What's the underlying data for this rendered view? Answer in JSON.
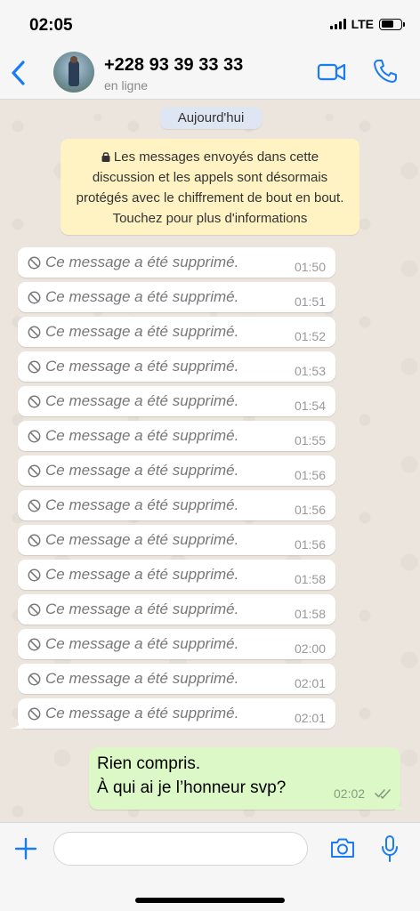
{
  "status_bar": {
    "time": "02:05",
    "network": "LTE",
    "battery_level": 0.62
  },
  "header": {
    "contact_name": "+228 93 39 33 33",
    "contact_status": "en ligne"
  },
  "chat": {
    "date_label": "Aujourd'hui",
    "encryption_notice": "Les messages envoyés dans cette discussion et les appels sont désormais protégés avec le chiffrement de bout en bout. Touchez pour plus d'informations",
    "deleted_messages": [
      {
        "text": "Ce message a été supprimé.",
        "time": "01:50"
      },
      {
        "text": "Ce message a été supprimé.",
        "time": "01:51"
      },
      {
        "text": "Ce message a été supprimé.",
        "time": "01:52"
      },
      {
        "text": "Ce message a été supprimé.",
        "time": "01:53"
      },
      {
        "text": "Ce message a été supprimé.",
        "time": "01:54"
      },
      {
        "text": "Ce message a été supprimé.",
        "time": "01:55"
      },
      {
        "text": "Ce message a été supprimé.",
        "time": "01:56"
      },
      {
        "text": "Ce message a été supprimé.",
        "time": "01:56"
      },
      {
        "text": "Ce message a été supprimé.",
        "time": "01:56"
      },
      {
        "text": "Ce message a été supprimé.",
        "time": "01:58"
      },
      {
        "text": "Ce message a été supprimé.",
        "time": "01:58"
      },
      {
        "text": "Ce message a été supprimé.",
        "time": "02:00"
      },
      {
        "text": "Ce message a été supprimé.",
        "time": "02:01"
      },
      {
        "text": "Ce message a été supprimé.",
        "time": "02:01"
      }
    ],
    "outgoing_message": {
      "line1": "Rien compris.",
      "line2": "À qui ai je l’honneur svp?",
      "time": "02:02"
    }
  },
  "input_bar": {
    "message_value": ""
  },
  "colors": {
    "accent": "#1a7cf5",
    "chat_background": "#ece5dd",
    "outgoing_bubble": "#dcf8c6",
    "encryption_notice_bg": "#fff3c4",
    "date_pill_bg": "#dde6f2"
  },
  "icons": {
    "back": "chevron-left-icon",
    "video": "video-camera-icon",
    "call": "phone-icon",
    "lock": "lock-icon",
    "deleted": "ban-icon",
    "read": "double-check-icon",
    "plus": "plus-icon",
    "camera": "camera-icon",
    "mic": "microphone-icon"
  }
}
